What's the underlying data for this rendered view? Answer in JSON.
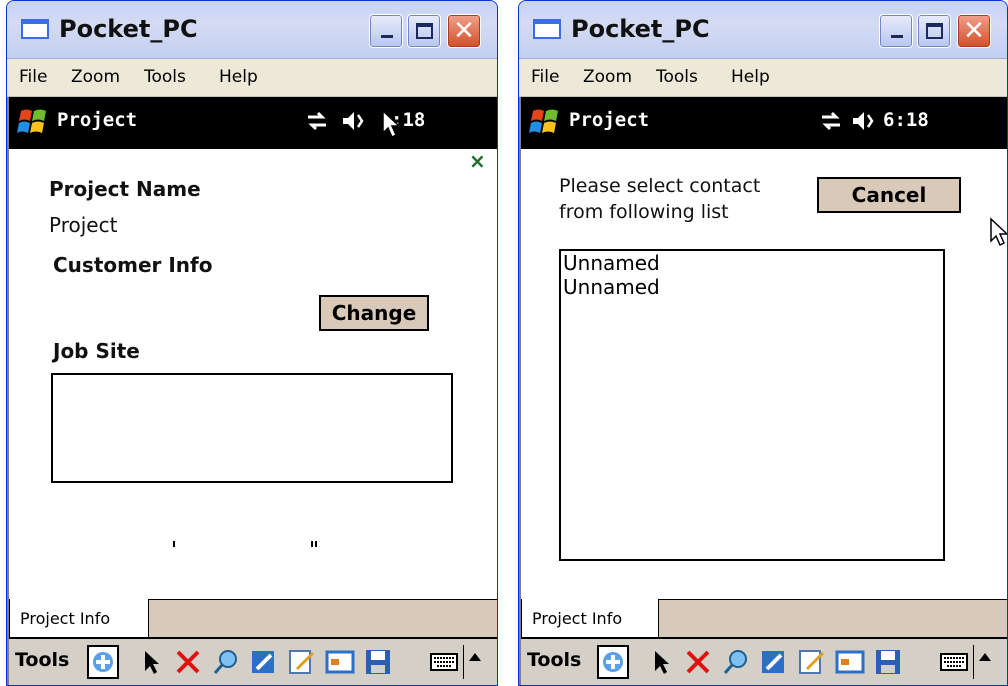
{
  "left_window": {
    "title": "Pocket_PC",
    "menu": [
      "File",
      "Zoom",
      "Tools",
      "Help"
    ],
    "taskbar": {
      "title": "Project",
      "time": ":18"
    },
    "content": {
      "project_name_label": "Project Name",
      "project_name_value": "Project",
      "customer_info_label": "Customer Info",
      "change_button": "Change",
      "job_site_label": "Job Site",
      "close_glyph": "×"
    },
    "tab": "Project Info",
    "command_bar": {
      "tools_label": "Tools"
    }
  },
  "right_window": {
    "title": "Pocket_PC",
    "menu": [
      "File",
      "Zoom",
      "Tools",
      "Help"
    ],
    "taskbar": {
      "title": "Project",
      "time": "6:18"
    },
    "content": {
      "prompt_line1": "Please select contact",
      "prompt_line2": "from following list",
      "cancel_button": "Cancel",
      "contacts": [
        "Unnamed",
        "Unnamed"
      ]
    },
    "tab": "Project Info",
    "command_bar": {
      "tools_label": "Tools"
    }
  },
  "icons": {
    "title": "pocket-pc-window-icon",
    "start": "windows-flag-icon",
    "sync": "sync-arrows-icon",
    "volume": "speaker-icon",
    "new": "plus-icon",
    "select": "pointer-icon",
    "delete": "red-x-icon",
    "find": "find-icon",
    "edit": "pencil-icon",
    "note": "note-icon",
    "card": "card-icon",
    "save": "floppy-save-icon",
    "keyboard": "keyboard-icon",
    "sip": "arrow-up-icon"
  },
  "colors": {
    "title_bar": "#c6d3f7",
    "taskbar": "#000000",
    "button_face": "#d9c9b8",
    "close_button": "#d0502a",
    "delete_red": "#e01010"
  }
}
